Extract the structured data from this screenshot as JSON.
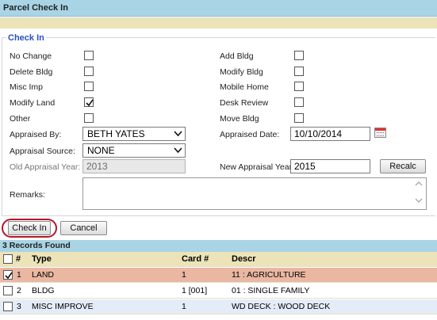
{
  "title": "Parcel Check In",
  "section_legend": "Check In",
  "left_checks": [
    {
      "label": "No Change",
      "checked": false
    },
    {
      "label": "Delete Bldg",
      "checked": false
    },
    {
      "label": "Misc Imp",
      "checked": false
    },
    {
      "label": "Modify Land",
      "checked": true
    },
    {
      "label": "Other",
      "checked": false
    }
  ],
  "right_checks": [
    {
      "label": "Add Bldg",
      "checked": false
    },
    {
      "label": "Modify Bldg",
      "checked": false
    },
    {
      "label": "Mobile Home",
      "checked": false
    },
    {
      "label": "Desk Review",
      "checked": false
    },
    {
      "label": "Move Bldg",
      "checked": false
    }
  ],
  "appraised_by": {
    "label": "Appraised By:",
    "value": "BETH YATES"
  },
  "appraised_date": {
    "label": "Appraised Date:",
    "value": "10/10/2014"
  },
  "appraisal_source": {
    "label": "Appraisal Source:",
    "value": "NONE"
  },
  "old_year": {
    "label": "Old Appraisal Year:",
    "value": "2013"
  },
  "new_year": {
    "label": "New Appraisal Year:",
    "value": "2015"
  },
  "recalc_label": "Recalc",
  "remarks_label": "Remarks:",
  "remarks_value": "",
  "check_in_label": "Check In",
  "cancel_label": "Cancel",
  "records_found": "3 Records Found",
  "table": {
    "headers": [
      "#",
      "Type",
      "Card #",
      "Descr"
    ],
    "rows": [
      {
        "num": "1",
        "type": "LAND",
        "card": "1",
        "descr": "11 : AGRICULTURE",
        "checked": true
      },
      {
        "num": "2",
        "type": "BLDG",
        "card": "1 [001]",
        "descr": "01 : SINGLE FAMILY",
        "checked": false
      },
      {
        "num": "3",
        "type": "MISC IMPROVE",
        "card": "1",
        "descr": "WD DECK : WOOD DECK",
        "checked": false
      }
    ]
  },
  "colors": {
    "header_bar": "#a9d4e5",
    "tan_bar": "#ece3b8",
    "selected_row": "#eab7a2",
    "legend": "#2a4fc4",
    "highlight_ring": "#b5162a"
  }
}
